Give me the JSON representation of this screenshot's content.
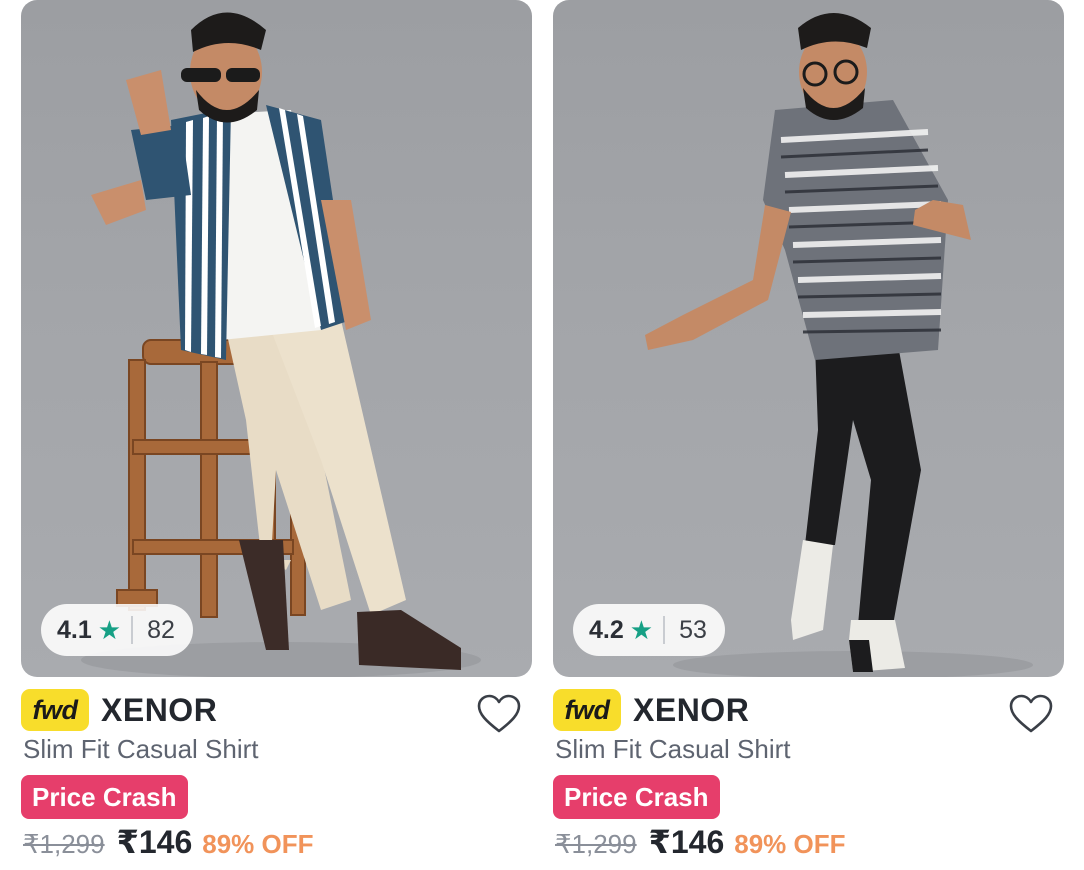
{
  "products": [
    {
      "rating": "4.1",
      "rating_count": "82",
      "badge_logo": "fwd",
      "brand": "XENOR",
      "title": "Slim Fit Casual Shirt",
      "tag": "Price Crash",
      "mrp": "₹1,299",
      "price": "₹146",
      "discount": "89% OFF",
      "shirt_style": "blue-white vertical stripes, white tee, beige chinos, wooden stool",
      "wishlist_icon": "heart-outline-icon"
    },
    {
      "rating": "4.2",
      "rating_count": "53",
      "badge_logo": "fwd",
      "brand": "XENOR",
      "title": "Slim Fit Casual Shirt",
      "tag": "Price Crash",
      "mrp": "₹1,299",
      "price": "₹146",
      "discount": "89% OFF",
      "shirt_style": "grey-white aztec print, black jeans, white sneakers",
      "wishlist_icon": "heart-outline-icon"
    }
  ],
  "colors": {
    "star": "#16a085",
    "fwd_badge": "#f8dd2b",
    "price_crash": "#e63e6b",
    "discount": "#f1935a"
  }
}
